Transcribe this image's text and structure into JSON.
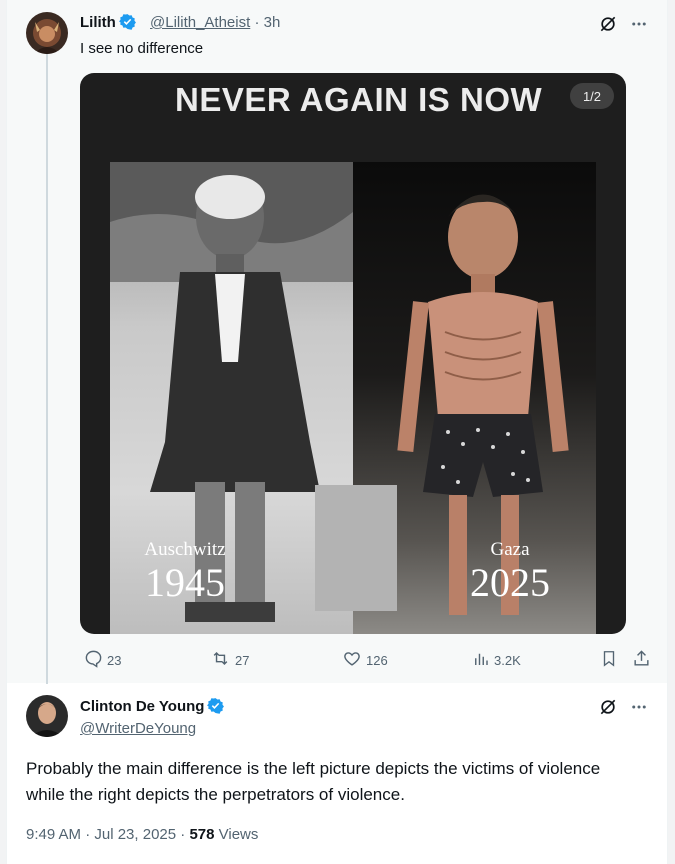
{
  "quoted_post": {
    "author_name": "Lilith",
    "author_handle": "@Lilith_Atheist",
    "time_sep": "·",
    "time": "3h",
    "text": "I see no difference",
    "media": {
      "title": "NEVER AGAIN IS NOW",
      "counter": "1/2",
      "left_place": "Auschwitz",
      "left_year": "1945",
      "right_place": "Gaza",
      "right_year": "2025"
    },
    "stats": {
      "replies": "23",
      "reposts": "27",
      "likes": "126",
      "views": "3.2K"
    }
  },
  "main_post": {
    "author_name": "Clinton De Young",
    "author_handle": "@WriterDeYoung",
    "text": "Probably the main difference is the left picture depicts the victims of violence while the right depicts the perpetrators of violence.",
    "timestamp": "9:49 AM · Jul 23, 2025 ·",
    "views_count": "578",
    "views_label": "Views"
  },
  "colors": {
    "verified": "#1d9bf0",
    "secondary_text": "#536471",
    "primary_text": "#0f1419"
  },
  "icons": [
    "verified-badge-icon",
    "grok-icon",
    "more-icon",
    "reply-icon",
    "repost-icon",
    "like-icon",
    "views-icon",
    "bookmark-icon",
    "share-icon"
  ]
}
